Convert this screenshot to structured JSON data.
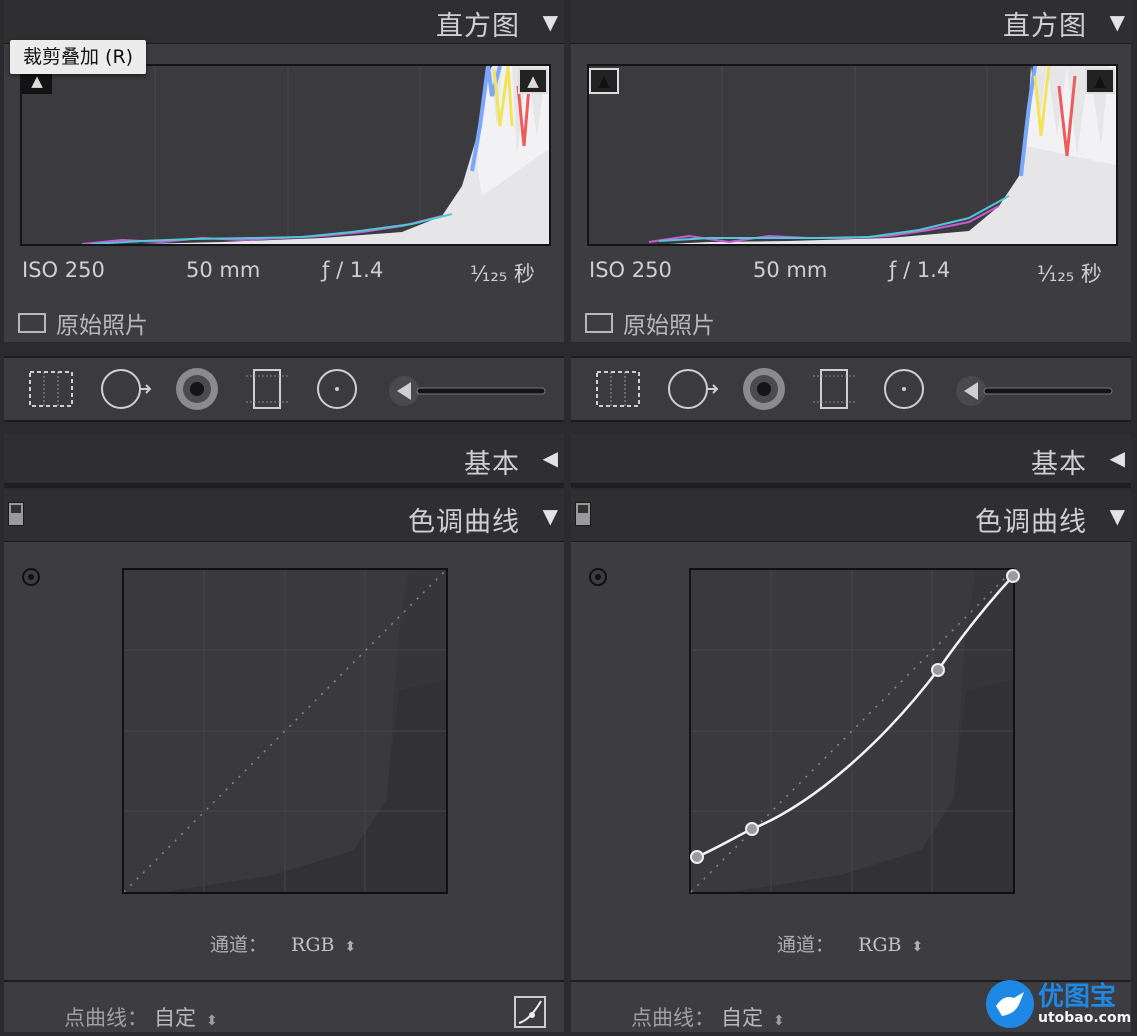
{
  "left": {
    "histogram": {
      "title": "直方图",
      "iso": "ISO 250",
      "focal": "50 mm",
      "aperture": "ƒ / 1.4",
      "shutter": "¹⁄₁₂₅ 秒",
      "original_photo_label": "原始照片"
    },
    "basic": {
      "title": "基本"
    },
    "tone_curve": {
      "title": "色调曲线",
      "channel_label": "通道：",
      "channel_value": "RGB",
      "point_curve_label": "点曲线：",
      "point_curve_value": "自定"
    },
    "tooltip": "裁剪叠加 (R)"
  },
  "right": {
    "histogram": {
      "title": "直方图",
      "iso": "ISO 250",
      "focal": "50 mm",
      "aperture": "ƒ / 1.4",
      "shutter": "¹⁄₁₂₅ 秒",
      "original_photo_label": "原始照片"
    },
    "basic": {
      "title": "基本"
    },
    "tone_curve": {
      "title": "色调曲线",
      "channel_label": "通道：",
      "channel_value": "RGB",
      "point_curve_label": "点曲线：",
      "point_curve_value": "自定"
    }
  },
  "watermark": {
    "name": "优图宝",
    "url": "utobao.com"
  },
  "icons": {
    "collapse": "triangle-down-icon",
    "expand": "triangle-left-icon",
    "target": "target-adjust-icon"
  },
  "colors": {
    "panel": "#3d3c40",
    "header": "#2f2e31",
    "curve": "#ffffff",
    "text": "#c9c9cb"
  }
}
